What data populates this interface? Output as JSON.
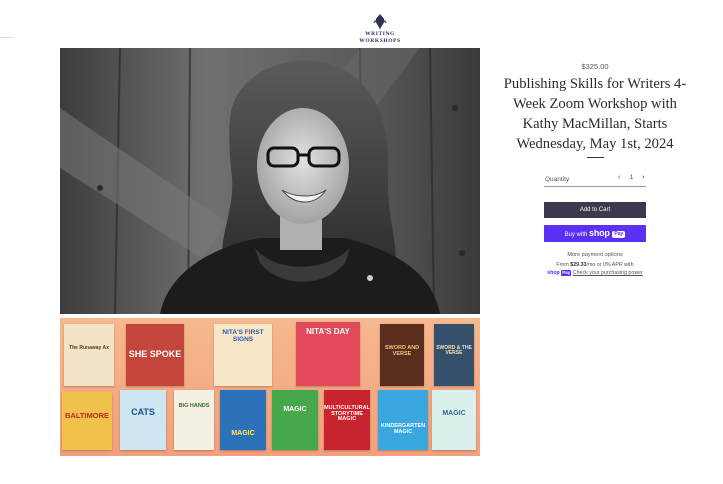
{
  "brand": {
    "logo_line1": "WRITING",
    "logo_line2": "WORKSHOPS",
    "logo_icon": "quill-pen-icon"
  },
  "product": {
    "price": "$325.00",
    "title": "Publishing Skills for Writers 4-Week Zoom Workshop with Kathy MacMillan, Starts Wednesday, May 1st, 2024",
    "hero_image": "black-and-white portrait",
    "quantity_label": "Quantity",
    "quantity_value": "1",
    "dec_icon": "chevron-left-icon",
    "inc_icon": "chevron-right-icon",
    "add_to_cart_label": "Add to Cart",
    "buy_with_label": "Buy with",
    "shop_brand": "shop",
    "shop_pay_badge": "Pay",
    "more_payment_label": "More payment options",
    "installment_prefix": "From ",
    "installment_amount": "$29.33",
    "installment_suffix": "/mo or 0% APR with",
    "check_power_label": "Check your purchasing power"
  },
  "book_covers": [
    {
      "text": "The Runaway Ax"
    },
    {
      "text": "SHE SPOKE"
    },
    {
      "text": "NITA'S FIRST SIGNS"
    },
    {
      "text": "NITA'S DAY"
    },
    {
      "text": "SWORD AND VERSE"
    },
    {
      "text": "SWORD & THE VERSE"
    },
    {
      "text": "BALTIMORE"
    },
    {
      "text": "CATS"
    },
    {
      "text": "BIG HANDS"
    },
    {
      "text": "MAGIC"
    },
    {
      "text": "MAGIC"
    },
    {
      "text": "MULTICULTURAL STORYTIME MAGIC"
    },
    {
      "text": "KINDERGARTEN MAGIC"
    },
    {
      "text": "MAGIC"
    }
  ],
  "colors": {
    "accent_dark": "#3a3a4d",
    "shop_purple": "#5a31f4",
    "logo_navy": "#2b2f5a"
  }
}
